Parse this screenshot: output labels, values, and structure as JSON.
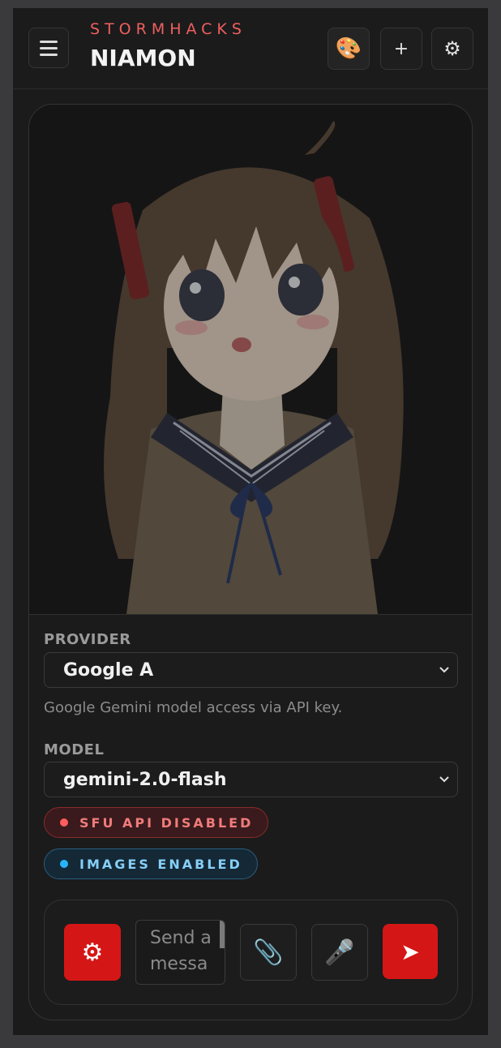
{
  "header": {
    "kicker": "STORMHACKS",
    "title": "NIAMON",
    "menu_icon": "hamburger-icon",
    "palette_icon": "🎨",
    "add_icon": "+",
    "settings_icon": "⚙"
  },
  "provider": {
    "label": "PROVIDER",
    "selected": "Google A",
    "description": "Google Gemini model access via API key."
  },
  "model": {
    "label": "MODEL",
    "selected": "gemini-2.0-flash"
  },
  "badges": {
    "sfu": "SFU API DISABLED",
    "images": "IMAGES ENABLED"
  },
  "composer": {
    "settings_icon": "⚙",
    "placeholder": "Send a message",
    "attach_icon": "📎",
    "mic_icon": "🎤",
    "send_icon": "➤"
  },
  "colors": {
    "accent": "#d51616",
    "brand_kicker": "#ef5f5f",
    "disabled": "#ff5c5c",
    "enabled": "#26b4ff"
  }
}
